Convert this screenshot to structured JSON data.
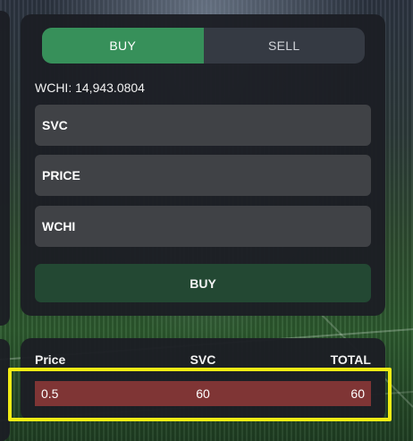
{
  "trade": {
    "buy_tab": "BUY",
    "sell_tab": "SELL",
    "balance": "WCHI: 14,943.0804",
    "fields": [
      {
        "placeholder": "SVC",
        "value": ""
      },
      {
        "placeholder": "PRICE",
        "value": ""
      },
      {
        "placeholder": "WCHI",
        "value": ""
      }
    ],
    "submit_label": "BUY"
  },
  "order_book": {
    "columns": [
      "Price",
      "SVC",
      "TOTAL"
    ],
    "rows": [
      {
        "price": "0.5",
        "svc": "60",
        "total": "60"
      }
    ]
  },
  "colors": {
    "active_tab": "#37905a",
    "submit_bg": "#234833",
    "sell_row": "#7f3535",
    "highlight": "#f2ec14"
  }
}
